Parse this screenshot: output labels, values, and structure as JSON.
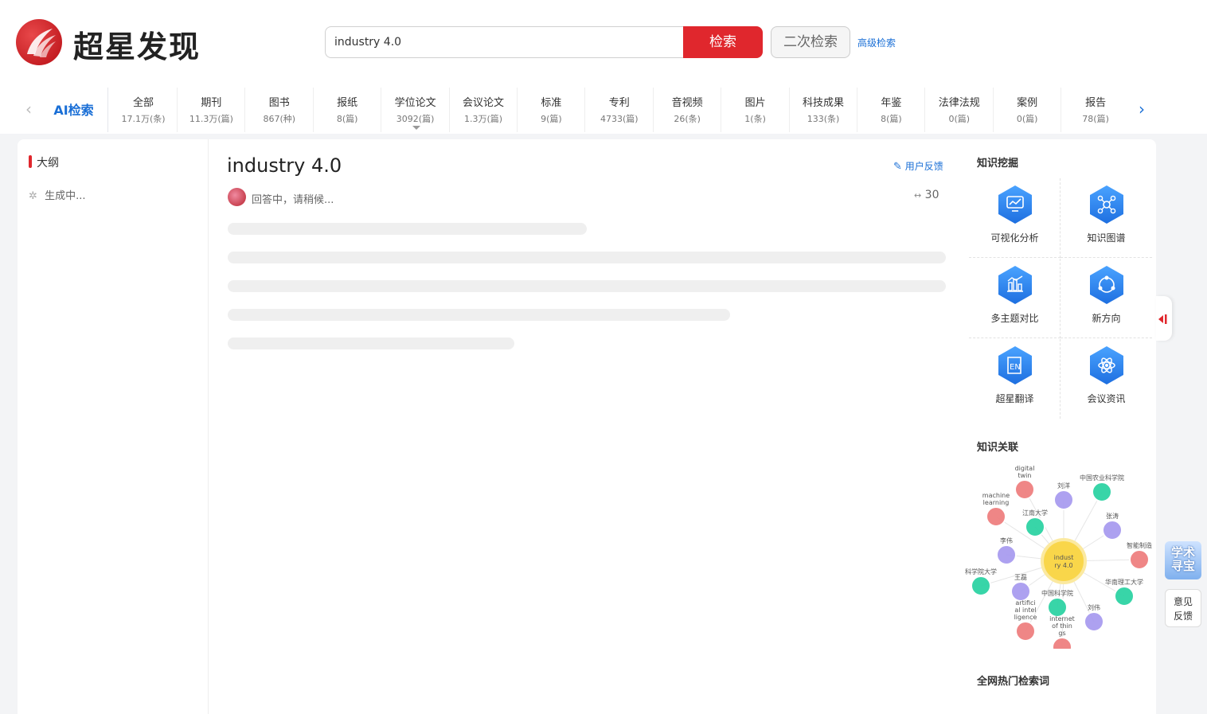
{
  "header": {
    "brand": "超星发现",
    "search_value": "industry 4.0",
    "search_button": "检索",
    "second_search": "二次检索",
    "advanced_search": "高级检索"
  },
  "tabs": {
    "ai": "AI检索",
    "items": [
      {
        "label": "全部",
        "count": "17.1万(条)"
      },
      {
        "label": "期刊",
        "count": "11.3万(篇)"
      },
      {
        "label": "图书",
        "count": "867(种)"
      },
      {
        "label": "报纸",
        "count": "8(篇)"
      },
      {
        "label": "学位论文",
        "count": "3092(篇)"
      },
      {
        "label": "会议论文",
        "count": "1.3万(篇)"
      },
      {
        "label": "标准",
        "count": "9(篇)"
      },
      {
        "label": "专利",
        "count": "4733(篇)"
      },
      {
        "label": "音视频",
        "count": "26(条)"
      },
      {
        "label": "图片",
        "count": "1(条)"
      },
      {
        "label": "科技成果",
        "count": "133(条)"
      },
      {
        "label": "年鉴",
        "count": "8(篇)"
      },
      {
        "label": "法律法规",
        "count": "0(篇)"
      },
      {
        "label": "案例",
        "count": "0(篇)"
      },
      {
        "label": "报告",
        "count": "78(篇)"
      }
    ]
  },
  "outline": {
    "title": "大纲",
    "generating": "生成中..."
  },
  "answer": {
    "title": "industry 4.0",
    "feedback": "用户反馈",
    "status": "回答中，请稍候...",
    "source_count": "30"
  },
  "right": {
    "knowledge_mining": "知识挖掘",
    "tools": [
      {
        "label": "可视化分析",
        "icon": "chart-icon"
      },
      {
        "label": "知识图谱",
        "icon": "graph-icon"
      },
      {
        "label": "多主题对比",
        "icon": "compare-icon"
      },
      {
        "label": "新方向",
        "icon": "direction-icon"
      },
      {
        "label": "超星翻译",
        "icon": "translate-icon"
      },
      {
        "label": "会议资讯",
        "icon": "conference-icon"
      }
    ],
    "knowledge_link": "知识关联",
    "graph": {
      "center": [
        "indust",
        "ry 4.0"
      ],
      "nodes": [
        {
          "label": [
            "digital",
            "twin"
          ],
          "color": "#ef8080"
        },
        {
          "label": [
            "刘洋"
          ],
          "color": "#a99cf0"
        },
        {
          "label": [
            "中国农业科学院"
          ],
          "color": "#2ed3a4"
        },
        {
          "label": [
            "machine",
            "learning"
          ],
          "color": "#ef8080"
        },
        {
          "label": [
            "江南大学"
          ],
          "color": "#2ed3a4"
        },
        {
          "label": [
            "张涛"
          ],
          "color": "#a99cf0"
        },
        {
          "label": [
            "李伟"
          ],
          "color": "#a99cf0"
        },
        {
          "label": [
            "智能制造"
          ],
          "color": "#ef8080"
        },
        {
          "label": [
            "科学院大学"
          ],
          "color": "#2ed3a4"
        },
        {
          "label": [
            "王磊"
          ],
          "color": "#a99cf0"
        },
        {
          "label": [
            "华南理工大学"
          ],
          "color": "#2ed3a4"
        },
        {
          "label": [
            "中国科学院"
          ],
          "color": "#2ed3a4"
        },
        {
          "label": [
            "artifici",
            "al intel",
            "ligence"
          ],
          "color": "#ef8080"
        },
        {
          "label": [
            "刘伟"
          ],
          "color": "#a99cf0"
        },
        {
          "label": [
            "internet",
            "of thin",
            "gs"
          ],
          "color": "#ef8080"
        }
      ]
    },
    "hot_words": "全网热门检索词"
  },
  "float": {
    "xueshu": "学术寻宝",
    "opinion": "意见反馈"
  },
  "colors": {
    "brand_red": "#e0272d",
    "link_blue": "#1a6fd6"
  }
}
